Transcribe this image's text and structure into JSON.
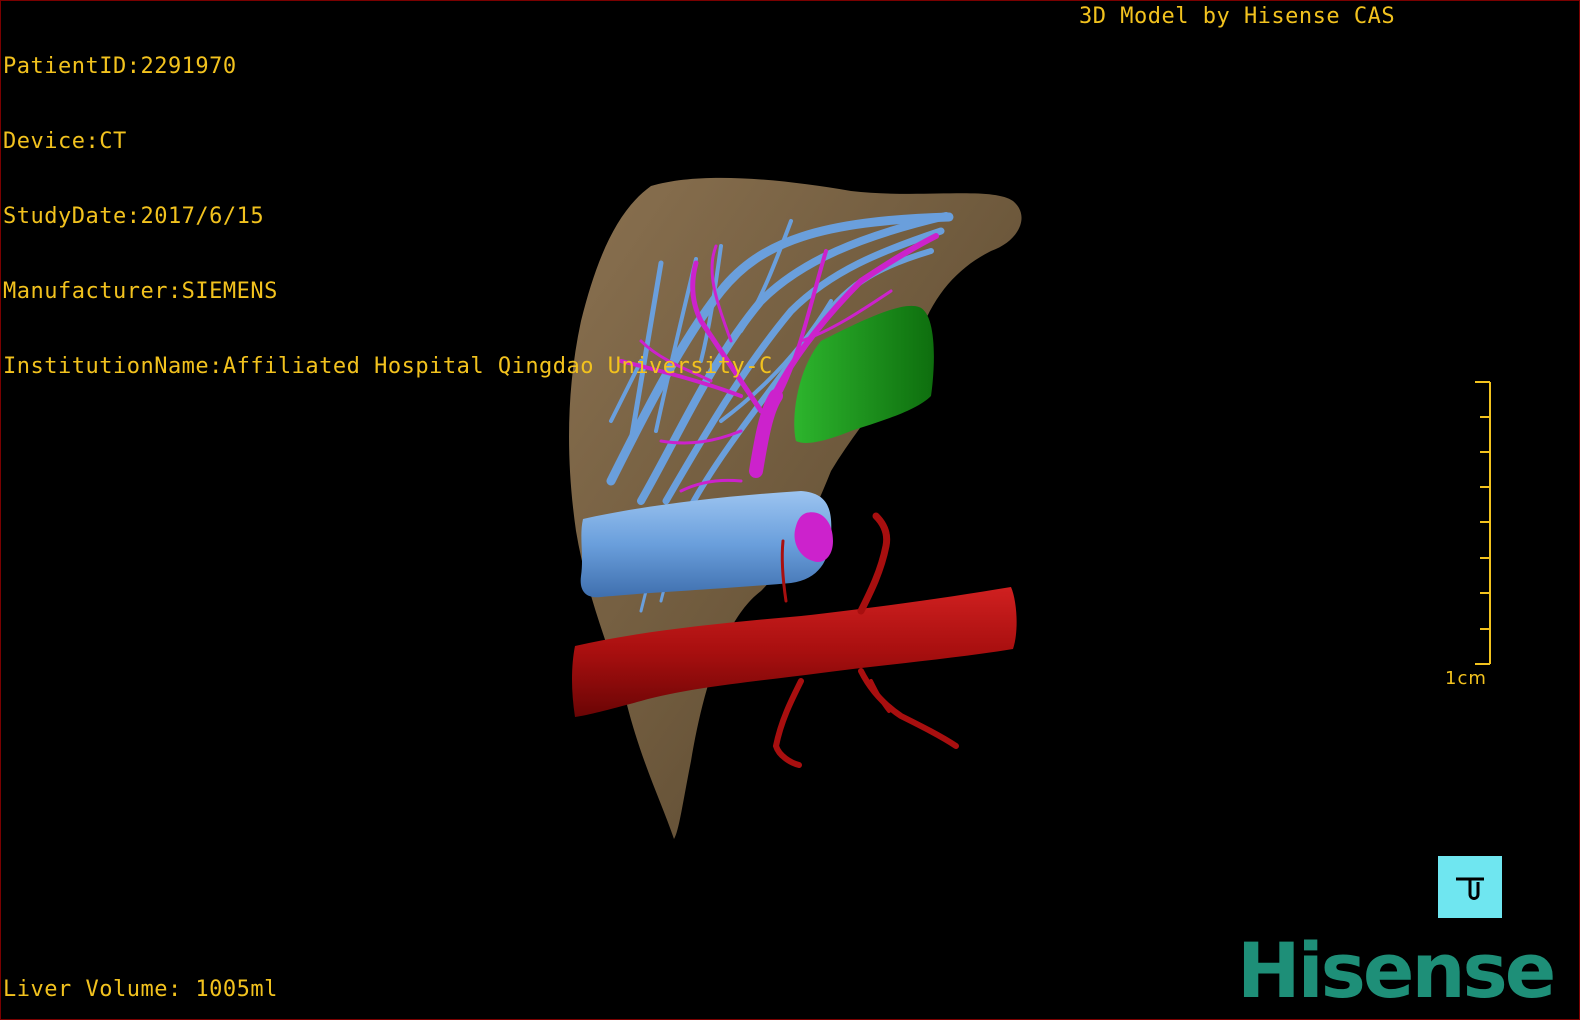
{
  "header": {
    "patient_id": "PatientID:2291970",
    "device": "Device:CT",
    "study_date": "StudyDate:2017/6/15",
    "manufacturer": "Manufacturer:SIEMENS",
    "institution": "InstitutionName:Affiliated Hospital Qingdao University-C"
  },
  "credit": "3D Model by Hisense CAS",
  "footer": {
    "liver_volume": "Liver Volume: 1005ml"
  },
  "scale": {
    "label": "1cm",
    "ticks": 9
  },
  "orientation": {
    "icon": "orientation-cube-icon"
  },
  "brand": {
    "logo_text": "Hisense",
    "color": "#1e8f78"
  },
  "model_colors": {
    "liver": "#7a6244",
    "hepatic_vein": "#6a9fdc",
    "portal_vein": "#cc22cc",
    "gallbladder": "#1f9a1f",
    "artery": "#b01010",
    "overlay_text": "#f2c21e"
  }
}
